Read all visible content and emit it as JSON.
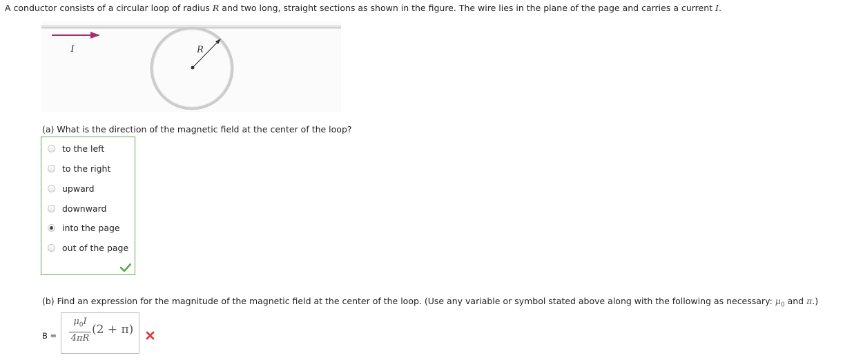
{
  "intro": {
    "part1": "A conductor consists of a circular loop of radius ",
    "var_R": "R",
    "part2": " and two long, straight sections as shown in the figure. The wire lies in the plane of the page and carries a current ",
    "var_I": "I",
    "part3": "."
  },
  "figure": {
    "current_label": "I",
    "radius_label": "R",
    "colors": {
      "wire": "#c9c9c9",
      "arrow": "#a3306b",
      "pointer": "#333333"
    }
  },
  "part_a": {
    "question": "(a) What is the direction of the magnetic field at the center of the loop?",
    "options": [
      "to the left",
      "to the right",
      "upward",
      "downward",
      "into the page",
      "out of the page"
    ],
    "selected": "into the page",
    "status": "correct",
    "status_icon": "check-icon",
    "colors": {
      "correct": "#5aa845"
    }
  },
  "part_b": {
    "question_pre": "(b) Find an expression for the magnitude of the magnetic field at the center of the loop. (Use any variable or symbol stated above along with the following as necessary: ",
    "sym_mu": "μ",
    "sym_mu_sub": "0",
    "question_and": " and ",
    "sym_pi": "π",
    "question_post": ".)",
    "label": "B =",
    "answer": {
      "numerator": "μ",
      "numerator_sub": "0",
      "numerator_var": "I",
      "denominator": "4πR",
      "factor": "(2 + π)"
    },
    "status": "incorrect",
    "status_icon": "x-icon",
    "colors": {
      "incorrect": "#e03b3b"
    }
  }
}
